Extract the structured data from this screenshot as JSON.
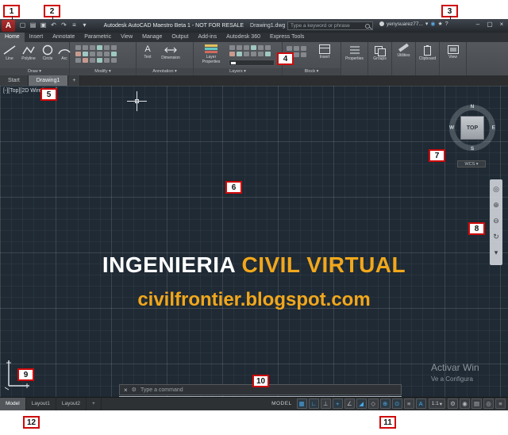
{
  "callouts": [
    "1",
    "2",
    "3",
    "4",
    "5",
    "6",
    "7",
    "8",
    "9",
    "10",
    "11",
    "12"
  ],
  "titlebar": {
    "logo_glyph": "A",
    "title": "Autodesk AutoCAD Maestro Beta 1 - NOT FOR RESALE",
    "filename": "Drawing1.dwg",
    "search_placeholder": "Type a keyword or phrase",
    "signin": "yenysuarez77...",
    "signin_caret": "▾",
    "a360_glyph": "◉",
    "star_glyph": "★",
    "help_glyph": "?",
    "win_min": "–",
    "win_max": "▢",
    "win_close": "×",
    "qat_icons": [
      {
        "n": "new-file-icon",
        "g": "▢"
      },
      {
        "n": "open-file-icon",
        "g": "▤"
      },
      {
        "n": "save-icon",
        "g": "▣"
      },
      {
        "n": "undo-icon",
        "g": "↶"
      },
      {
        "n": "redo-icon",
        "g": "↷"
      },
      {
        "n": "plot-icon",
        "g": "≡"
      },
      {
        "n": "qat-dropdown-icon",
        "g": "▾"
      }
    ]
  },
  "ribbon": {
    "tabs": [
      "Home",
      "Insert",
      "Annotate",
      "Parametric",
      "View",
      "Manage",
      "Output",
      "Add-ins",
      "Autodesk 360",
      "Express Tools"
    ],
    "draw_tools": [
      "Line",
      "Polyline",
      "Circle",
      "Arc"
    ],
    "annotation_tools": [
      "Text",
      "Dimension"
    ],
    "text_icon_glyph": "A",
    "layers_big_label": "Layer Properties",
    "block_big_label": "Insert",
    "right_panels": [
      "Properties",
      "Groups",
      "Utilities",
      "Clipboard",
      "View"
    ],
    "panel_labels": [
      "Draw ▾",
      "Modify ▾",
      "Annotation ▾",
      "Layers ▾",
      "Block ▾"
    ]
  },
  "file_tabs": {
    "start": "Start",
    "drawing": "Drawing1",
    "new_tab": "+"
  },
  "canvas": {
    "viewport_label": "[-][Top][2D Wireframe]",
    "viewcube": {
      "n": "N",
      "w": "W",
      "e": "E",
      "s": "S",
      "top": "TOP",
      "wcs": "WCS ▾"
    },
    "watermark": {
      "line1_white": "INGENIERIA",
      "line1_accent": "CIVIL VIRTUAL",
      "line2": "civilfrontier.blogspot.com",
      "accent_color": "#f2a71b"
    },
    "activation": {
      "line1": "Activar Win",
      "line2": "Ve a Configura"
    },
    "navbar_icons": [
      {
        "n": "navigation-wheel-icon",
        "g": "◎"
      },
      {
        "n": "pan-icon",
        "g": "⊕"
      },
      {
        "n": "zoom-icon",
        "g": "⊖"
      },
      {
        "n": "orbit-icon",
        "g": "↻"
      },
      {
        "n": "showmotion-icon",
        "g": "▾"
      }
    ]
  },
  "command_line": {
    "close_glyph": "×",
    "customize_glyph": "⚙",
    "placeholder": "Type a command"
  },
  "statusbar": {
    "layout_tabs": [
      "Model",
      "Layout1",
      "Layout2",
      "+"
    ],
    "model_label": "MODEL",
    "scale": "1:1",
    "scale_caret": "▾",
    "icons_a": [
      {
        "n": "grid-icon",
        "g": "▦",
        "on": true
      },
      {
        "n": "snap-icon",
        "g": "∟",
        "on": true
      },
      {
        "n": "infer-constraints-icon",
        "g": "⊥",
        "on": false
      },
      {
        "n": "dynamic-input-icon",
        "g": "+",
        "on": true
      },
      {
        "n": "ortho-icon",
        "g": "∠",
        "on": false
      },
      {
        "n": "polar-tracking-icon",
        "g": "◢",
        "on": true
      },
      {
        "n": "isodraft-icon",
        "g": "◇",
        "on": false
      },
      {
        "n": "osnap-tracking-icon",
        "g": "⊕",
        "on": true
      },
      {
        "n": "osnap-icon",
        "g": "⊙",
        "on": true
      },
      {
        "n": "lineweight-icon",
        "g": "≡",
        "on": false
      },
      {
        "n": "annotation-visibility-icon",
        "g": "A",
        "on": true
      }
    ],
    "icons_b": [
      {
        "n": "workspace-switching-icon",
        "g": "⚙",
        "on": false
      },
      {
        "n": "annotation-monitor-icon",
        "g": "◉",
        "on": false
      },
      {
        "n": "quick-properties-icon",
        "g": "▤",
        "on": false
      },
      {
        "n": "isolate-objects-icon",
        "g": "◎",
        "on": false
      },
      {
        "n": "customization-icon",
        "g": "≡",
        "on": false
      }
    ]
  }
}
